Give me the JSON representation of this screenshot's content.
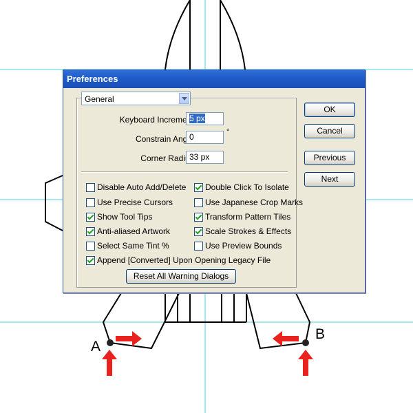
{
  "canvas": {
    "point_a_label": "A",
    "point_b_label": "B",
    "guide_color": "#47d3dd",
    "arrow_color": "#e8221e"
  },
  "dialog": {
    "title": "Preferences",
    "section_value": "General",
    "fields": [
      {
        "label": "Keyboard Increment:",
        "value": "5 px"
      },
      {
        "label": "Constrain Angle:",
        "value": "0",
        "unit": "°"
      },
      {
        "label": "Corner Radius:",
        "value": "33 px"
      }
    ],
    "checkboxes": [
      {
        "label": "Disable Auto Add/Delete",
        "checked": false
      },
      {
        "label": "Use Precise Cursors",
        "checked": false
      },
      {
        "label": "Show Tool Tips",
        "checked": true
      },
      {
        "label": "Anti-aliased Artwork",
        "checked": true
      },
      {
        "label": "Select Same Tint %",
        "checked": false
      },
      {
        "label": "Double Click To Isolate",
        "checked": true
      },
      {
        "label": "Use Japanese Crop Marks",
        "checked": false
      },
      {
        "label": "Transform Pattern Tiles",
        "checked": true
      },
      {
        "label": "Scale Strokes & Effects",
        "checked": true
      },
      {
        "label": "Use Preview Bounds",
        "checked": false
      },
      {
        "label": "Append [Converted] Upon Opening Legacy File",
        "checked": true
      }
    ],
    "reset_button": "Reset All Warning Dialogs",
    "buttons": {
      "ok": "OK",
      "cancel": "Cancel",
      "previous": "Previous",
      "next": "Next"
    }
  }
}
